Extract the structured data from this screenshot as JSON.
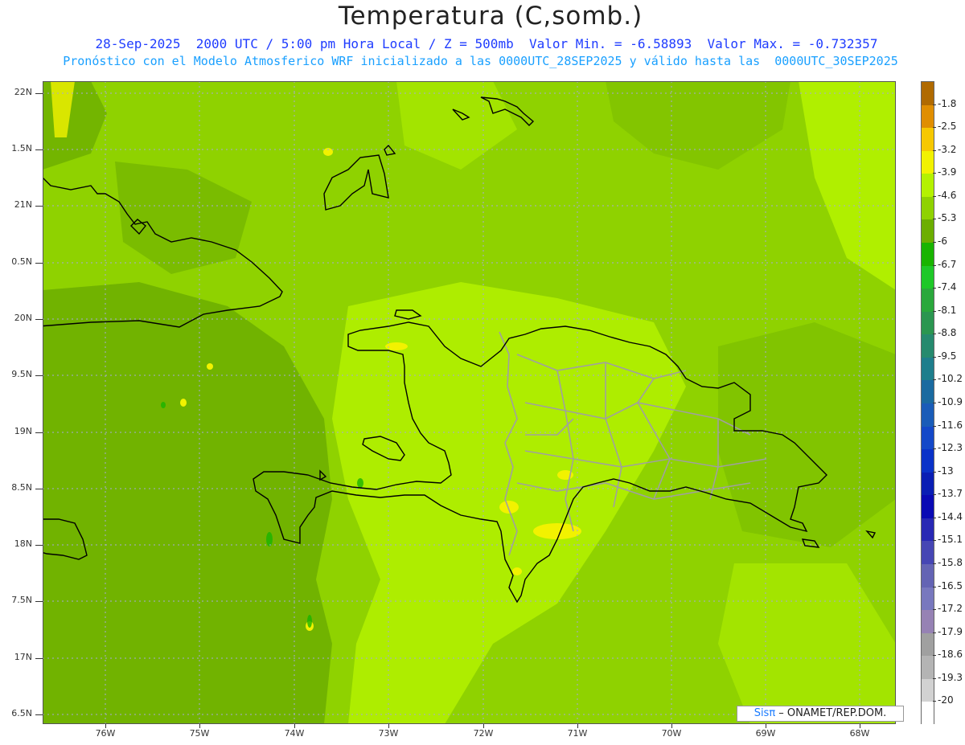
{
  "title": "Temperatura (C,somb.)",
  "subtitle_line1": "28-Sep-2025  2000 UTC / 5:00 pm Hora Local / Z = 500mb  Valor Min. = -6.58893  Valor Max. = -0.732357",
  "subtitle_line2": "Pronóstico con el Modelo Atmosferico WRF inicializado a las 0000UTC_28SEP2025 y válido hasta las  0000UTC_30SEP2025",
  "y_axis_labels": [
    "22N",
    "1.5N",
    "21N",
    "0.5N",
    "20N",
    "9.5N",
    "19N",
    "8.5N",
    "18N",
    "7.5N",
    "17N",
    "6.5N"
  ],
  "x_axis_labels": [
    "76W",
    "75W",
    "74W",
    "73W",
    "72W",
    "71W",
    "70W",
    "69W",
    "68W"
  ],
  "colorbar": {
    "labels": [
      "-1.8",
      "-2.5",
      "-3.2",
      "-3.9",
      "-4.6",
      "-5.3",
      "-6",
      "-6.7",
      "-7.4",
      "-8.1",
      "-8.8",
      "-9.5",
      "-10.2",
      "-10.9",
      "-11.6",
      "-12.3",
      "-13",
      "-13.7",
      "-14.4",
      "-15.1",
      "-15.8",
      "-16.5",
      "-17.2",
      "-17.9",
      "-18.6",
      "-19.3",
      "-20"
    ],
    "colors": [
      "#b06a00",
      "#e08e00",
      "#f6c800",
      "#f2f200",
      "#b4f200",
      "#8fd200",
      "#6cae00",
      "#19b400",
      "#1ec828",
      "#2aa83c",
      "#2b9650",
      "#268a6e",
      "#1e7e8c",
      "#1a6aa0",
      "#1a5cb8",
      "#1448c8",
      "#0a32c8",
      "#0a1eb4",
      "#0a0ab4",
      "#2828b4",
      "#4646b4",
      "#6464b4",
      "#7878be",
      "#9682b4",
      "#a0a0a0",
      "#b4b4b4",
      "#d2d2d2",
      "#ffffff"
    ]
  },
  "map_colors": {
    "base_green": "#8fd200",
    "light_green": "#b4f200",
    "dark_green": "#6cae00",
    "yellow": "#f2f200",
    "coast": "#000000",
    "borders": "#a0a0a0"
  },
  "credit": {
    "sis": "Sisπ",
    "rest": " – ONAMET/REP.DOM."
  }
}
